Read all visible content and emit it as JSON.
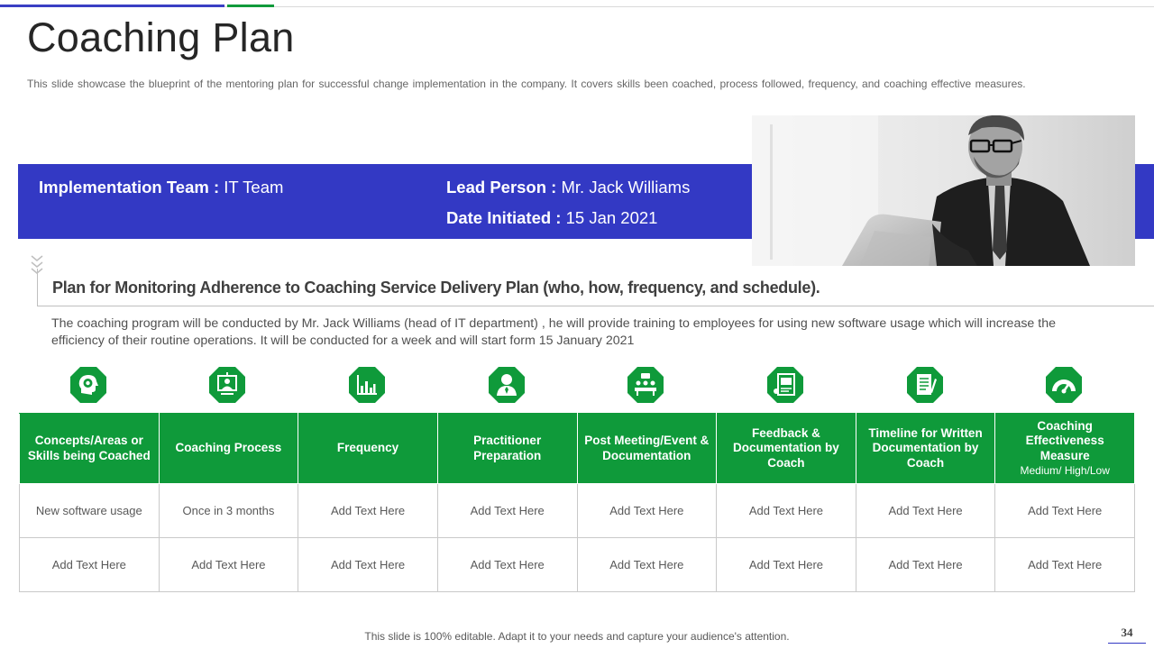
{
  "slide": {
    "title": "Coaching Plan",
    "subtitle": "This slide showcase the blueprint of the mentoring plan for successful change implementation in the company. It covers skills been coached, process followed, frequency, and coaching effective measures.",
    "footer": "This slide is 100% editable. Adapt it to your needs and capture your audience's attention.",
    "page_number": "34"
  },
  "banner": {
    "team_label": "Implementation Team : ",
    "team_value": "IT Team",
    "lead_label": "Lead Person : ",
    "lead_value": "Mr. Jack Williams",
    "date_label": "Date Initiated : ",
    "date_value": "15 Jan 2021"
  },
  "section": {
    "title": "Plan for Monitoring Adherence to Coaching Service Delivery Plan (who, how, frequency, and schedule).",
    "description": "The coaching program will be conducted by Mr. Jack Williams (head of IT department) , he will provide training to employees for using new software usage which will increase the efficiency of their routine operations. It will be conducted for a week and will start form 15 January 2021"
  },
  "icons": [
    "gear-head-icon",
    "presentation-board-icon",
    "bar-chart-icon",
    "person-tie-icon",
    "meeting-icon",
    "feedback-document-icon",
    "document-pen-icon",
    "speedometer-icon"
  ],
  "colors": {
    "blue": "#3339c4",
    "green": "#0f9a3a"
  },
  "table": {
    "headers": [
      "Concepts/Areas or Skills being Coached",
      "Coaching Process",
      "Frequency",
      "Practitioner Preparation",
      "Post Meeting/Event & Documentation",
      "Feedback & Documentation by Coach",
      "Timeline for Written Documentation by Coach",
      "Coaching Effectiveness Measure"
    ],
    "header_note": "Medium/ High/Low",
    "rows": [
      [
        "New software usage",
        "Once in 3 months",
        "Add Text Here",
        "Add Text Here",
        "Add Text Here",
        "Add Text Here",
        "Add Text Here",
        "Add Text Here"
      ],
      [
        "Add Text Here",
        "Add Text Here",
        "Add Text Here",
        "Add Text Here",
        "Add Text Here",
        "Add Text Here",
        "Add Text Here",
        "Add Text Here"
      ]
    ]
  }
}
